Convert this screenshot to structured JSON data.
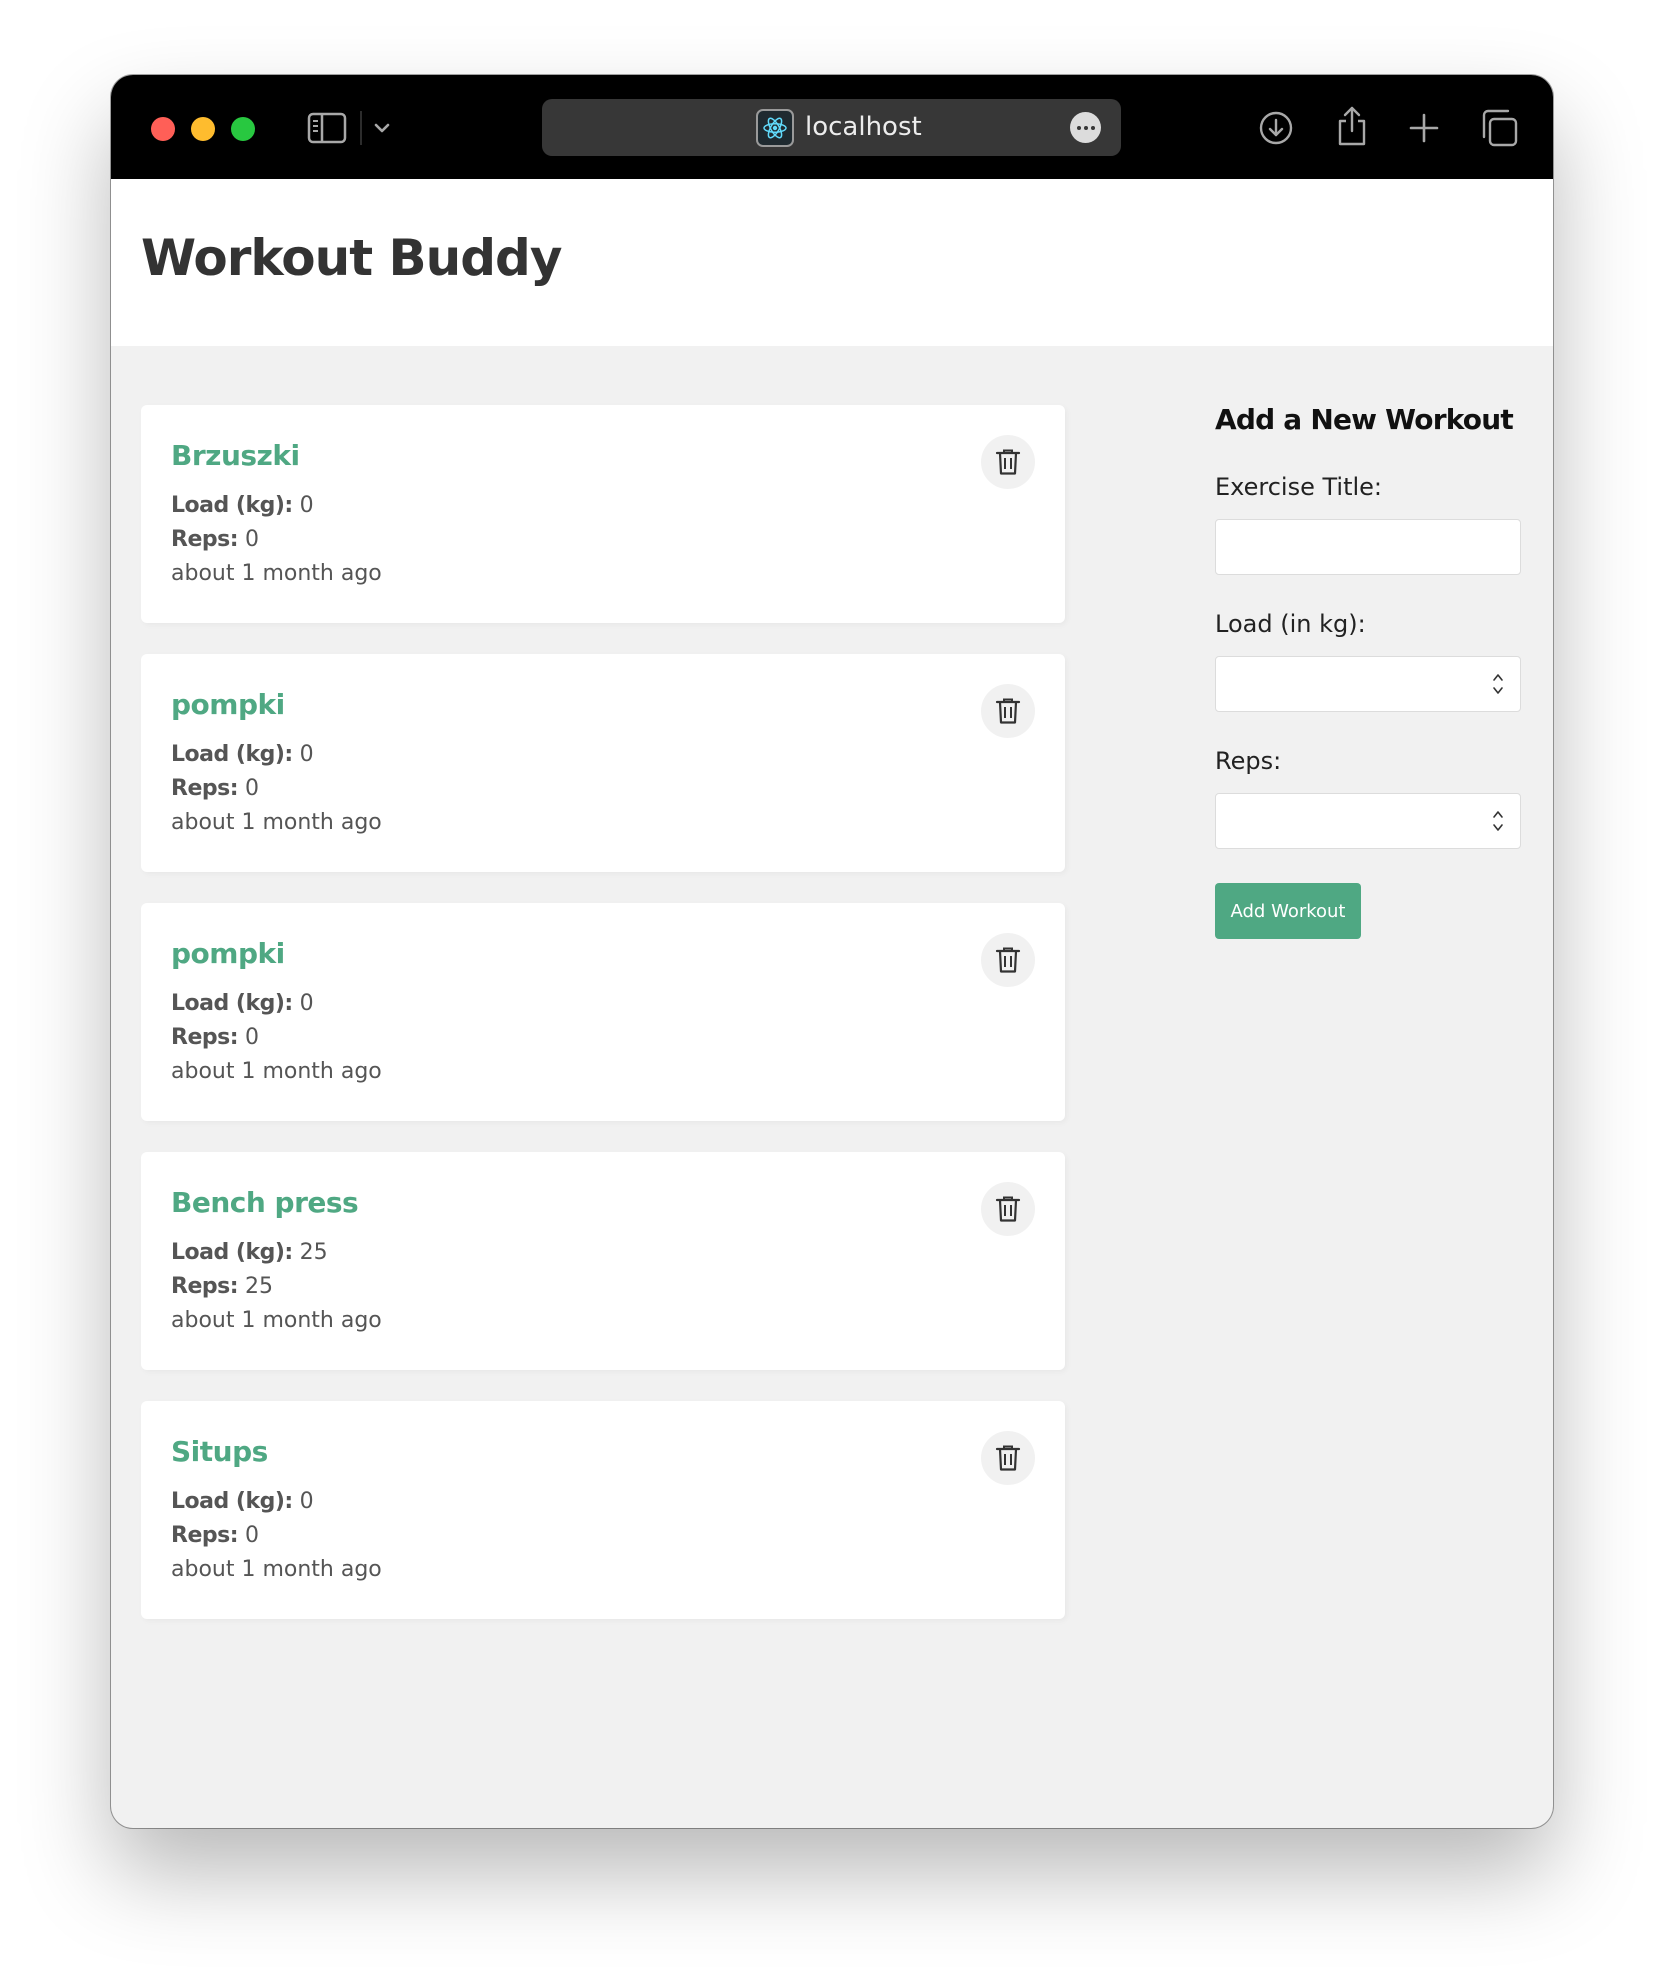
{
  "browser": {
    "url": "localhost",
    "site_icon": "react-atom-icon"
  },
  "header": {
    "title": "Workout Buddy"
  },
  "workouts": [
    {
      "title": "Brzuszki",
      "load_label": "Load (kg):",
      "load": "0",
      "reps_label": "Reps:",
      "reps": "0",
      "time": "about 1 month ago"
    },
    {
      "title": "pompki",
      "load_label": "Load (kg):",
      "load": "0",
      "reps_label": "Reps:",
      "reps": "0",
      "time": "about 1 month ago"
    },
    {
      "title": "pompki",
      "load_label": "Load (kg):",
      "load": "0",
      "reps_label": "Reps:",
      "reps": "0",
      "time": "about 1 month ago"
    },
    {
      "title": "Bench press",
      "load_label": "Load (kg):",
      "load": "25",
      "reps_label": "Reps:",
      "reps": "25",
      "time": "about 1 month ago"
    },
    {
      "title": "Situps",
      "load_label": "Load (kg):",
      "load": "0",
      "reps_label": "Reps:",
      "reps": "0",
      "time": "about 1 month ago"
    }
  ],
  "form": {
    "title": "Add a New Workout",
    "exercise_label": "Exercise Title:",
    "exercise_value": "",
    "load_label": "Load (in kg):",
    "load_value": "",
    "reps_label": "Reps:",
    "reps_value": "",
    "submit_label": "Add Workout"
  },
  "colors": {
    "accent": "#4fa883",
    "page_bg": "#f1f1f1",
    "toolbar_bg": "#000000"
  }
}
